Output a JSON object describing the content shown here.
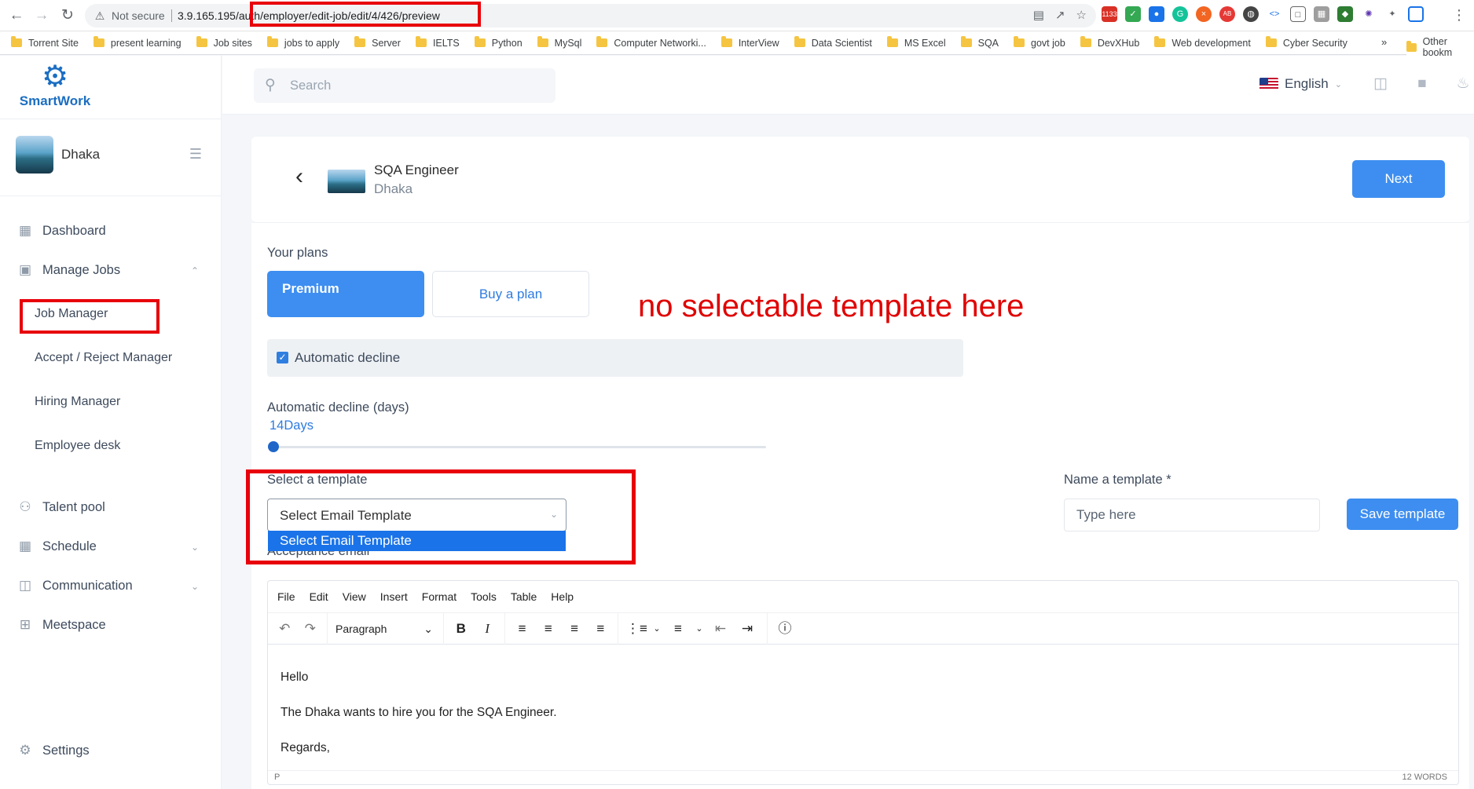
{
  "browser": {
    "security": "Not secure",
    "url": "3.9.165.195/auth/employer/edit-job/edit/4/426/preview",
    "gmail_badge": "1133"
  },
  "bookmarks": [
    "Torrent Site",
    "present learning",
    "Job sites",
    "jobs to apply",
    "Server",
    "IELTS",
    "Python",
    "MySql",
    "Computer Networki...",
    "InterView",
    "Data Scientist",
    "MS Excel",
    "SQA",
    "govt job",
    "DevXHub",
    "Web development",
    "Cyber Security"
  ],
  "bookmarks_more": "»",
  "bookmarks_other": "Other bookm",
  "sidebar": {
    "brand": "SmartWork",
    "org_name": "Dhaka",
    "menu": {
      "dashboard": "Dashboard",
      "manage_jobs": "Manage Jobs",
      "job_manager": "Job Manager",
      "accept_reject": "Accept / Reject Manager",
      "hiring_manager": "Hiring Manager",
      "employee_desk": "Employee desk",
      "talent_pool": "Talent pool",
      "schedule": "Schedule",
      "communication": "Communication",
      "meetspace": "Meetspace",
      "settings": "Settings"
    }
  },
  "topbar": {
    "search_placeholder": "Search",
    "language": "English"
  },
  "job": {
    "title": "SQA Engineer",
    "location": "Dhaka",
    "next_label": "Next"
  },
  "form": {
    "plans_label": "Your plans",
    "premium_label": "Premium",
    "buy_plan_label": "Buy a plan",
    "annotation": "no selectable template here",
    "auto_decline_label": "Automatic decline",
    "auto_decline_days_label": "Automatic decline (days)",
    "days_value": "14Days",
    "select_template_label": "Select a template",
    "select_value": "Select Email Template",
    "dropdown_option": "Select Email Template",
    "acceptance_label": "Acceptance email",
    "name_template_label": "Name a template *",
    "name_placeholder": "Type here",
    "save_template_label": "Save template"
  },
  "editor": {
    "menu": [
      "File",
      "Edit",
      "View",
      "Insert",
      "Format",
      "Tools",
      "Table",
      "Help"
    ],
    "block_format": "Paragraph",
    "content": [
      "Hello",
      "The Dhaka wants to hire you for the SQA Engineer.",
      "Regards,"
    ],
    "path": "P",
    "word_count": "12 WORDS"
  },
  "colors": {
    "primary": "#3d8ef0",
    "annotation_red": "#e00000",
    "brand_blue": "#1b6ec2"
  }
}
